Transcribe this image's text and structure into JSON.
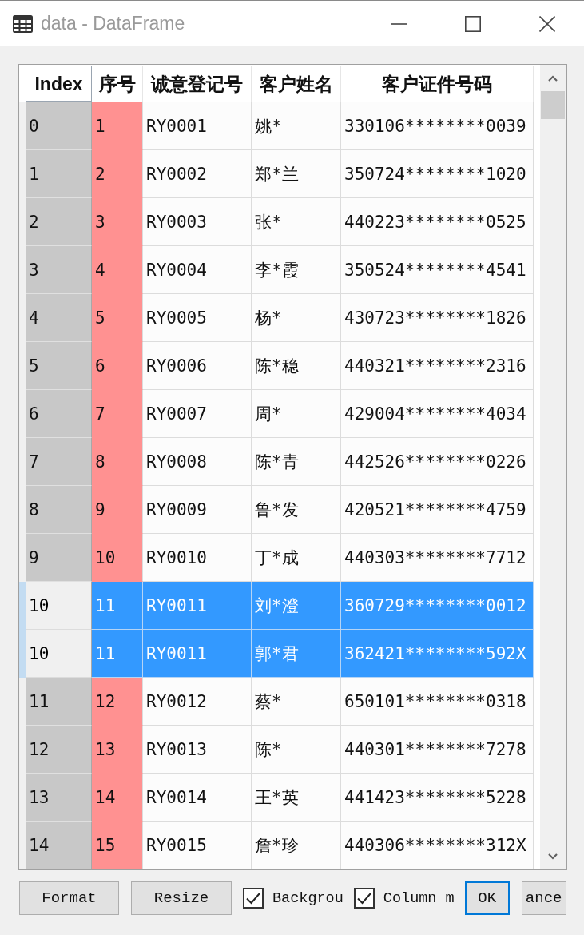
{
  "window": {
    "title": "data - DataFrame"
  },
  "table": {
    "columns": [
      {
        "label": "Index",
        "kind": "index"
      },
      {
        "label": "序号",
        "kind": "numeric"
      },
      {
        "label": "诚意登记号",
        "kind": "text"
      },
      {
        "label": "客户姓名",
        "kind": "text"
      },
      {
        "label": "客户证件号码",
        "kind": "text"
      }
    ],
    "rows": [
      {
        "cells": [
          "0",
          "1",
          "RY0001",
          "姚*",
          "330106********0039"
        ],
        "selected": false
      },
      {
        "cells": [
          "1",
          "2",
          "RY0002",
          "郑*兰",
          "350724********1020"
        ],
        "selected": false
      },
      {
        "cells": [
          "2",
          "3",
          "RY0003",
          "张*",
          "440223********0525"
        ],
        "selected": false
      },
      {
        "cells": [
          "3",
          "4",
          "RY0004",
          "李*霞",
          "350524********4541"
        ],
        "selected": false
      },
      {
        "cells": [
          "4",
          "5",
          "RY0005",
          "杨*",
          "430723********1826"
        ],
        "selected": false
      },
      {
        "cells": [
          "5",
          "6",
          "RY0006",
          "陈*稳",
          "440321********2316"
        ],
        "selected": false
      },
      {
        "cells": [
          "6",
          "7",
          "RY0007",
          "周*",
          "429004********4034"
        ],
        "selected": false
      },
      {
        "cells": [
          "7",
          "8",
          "RY0008",
          "陈*青",
          "442526********0226"
        ],
        "selected": false
      },
      {
        "cells": [
          "8",
          "9",
          "RY0009",
          "鲁*发",
          "420521********4759"
        ],
        "selected": false
      },
      {
        "cells": [
          "9",
          "10",
          "RY0010",
          "丁*成",
          "440303********7712"
        ],
        "selected": false
      },
      {
        "cells": [
          "10",
          "11",
          "RY0011",
          "刘*澄",
          "360729********0012"
        ],
        "selected": true
      },
      {
        "cells": [
          "10",
          "11",
          "RY0011",
          "郭*君",
          "362421********592X"
        ],
        "selected": true
      },
      {
        "cells": [
          "11",
          "12",
          "RY0012",
          "蔡*",
          "650101********0318"
        ],
        "selected": false
      },
      {
        "cells": [
          "12",
          "13",
          "RY0013",
          "陈*",
          "440301********7278"
        ],
        "selected": false
      },
      {
        "cells": [
          "13",
          "14",
          "RY0014",
          "王*英",
          "441423********5228"
        ],
        "selected": false
      },
      {
        "cells": [
          "14",
          "15",
          "RY0015",
          "詹*珍",
          "440306********312X"
        ],
        "selected": false
      }
    ]
  },
  "controls": [
    {
      "kind": "button",
      "label": "Format",
      "focused": false
    },
    {
      "kind": "button",
      "label": "Resize",
      "focused": false
    },
    {
      "kind": "checkbox",
      "label": "Backgrou",
      "checked": true
    },
    {
      "kind": "checkbox",
      "label": "Column m",
      "checked": true
    },
    {
      "kind": "button",
      "label": "OK",
      "focused": true
    },
    {
      "kind": "button",
      "label": "ance",
      "focused": false
    }
  ]
}
